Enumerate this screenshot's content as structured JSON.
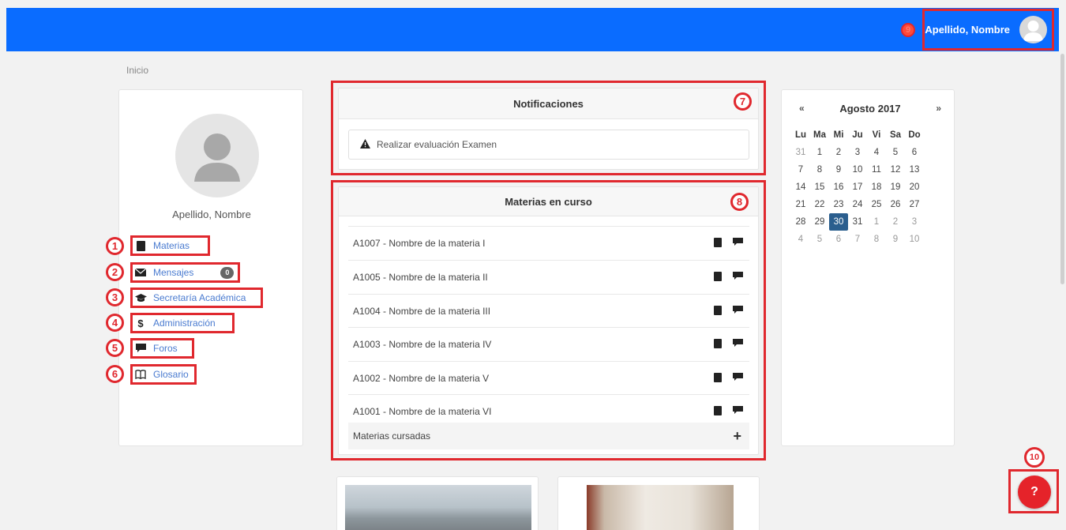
{
  "header": {
    "user_name": "Apellido, Nombre",
    "marker_user": "9",
    "accent_color": "#0a6cff"
  },
  "breadcrumb": "Inicio",
  "profile": {
    "name": "Apellido, Nombre",
    "menu": [
      {
        "marker": "1",
        "label": "Materias",
        "icon": "book-icon"
      },
      {
        "marker": "2",
        "label": "Mensajes",
        "icon": "envelope-icon",
        "count": "0"
      },
      {
        "marker": "3",
        "label": "Secretaría Académica",
        "icon": "graduation-cap-icon"
      },
      {
        "marker": "4",
        "label": "Administración",
        "icon": "dollar-icon"
      },
      {
        "marker": "5",
        "label": "Foros",
        "icon": "comment-icon"
      },
      {
        "marker": "6",
        "label": "Glosario",
        "icon": "open-book-icon"
      }
    ]
  },
  "notifications": {
    "title": "Notificaciones",
    "marker": "7",
    "items": [
      "Realizar evaluación Examen"
    ]
  },
  "courses": {
    "title": "Materias en curso",
    "marker": "8",
    "items": [
      "A1007 - Nombre de la materia I",
      "A1005 - Nombre de la materia II",
      "A1004 - Nombre de la materia III",
      "A1003 - Nombre de la materia IV",
      "A1002 - Nombre de la materia V",
      "A1001 - Nombre de la materia VI"
    ],
    "completed_label": "Materias cursadas",
    "completed_action": "+"
  },
  "calendar": {
    "prev": "«",
    "title": "Agosto 2017",
    "next": "»",
    "weekdays": [
      "Lu",
      "Ma",
      "Mi",
      "Ju",
      "Vi",
      "Sa",
      "Do"
    ],
    "days": [
      "31",
      "1",
      "2",
      "3",
      "4",
      "5",
      "6",
      "7",
      "8",
      "9",
      "10",
      "11",
      "12",
      "13",
      "14",
      "15",
      "16",
      "17",
      "18",
      "19",
      "20",
      "21",
      "22",
      "23",
      "24",
      "25",
      "26",
      "27",
      "28",
      "29",
      "30",
      "31",
      "1",
      "2",
      "3",
      "4",
      "5",
      "6",
      "7",
      "8",
      "9",
      "10"
    ],
    "selected": "30"
  },
  "help": {
    "marker": "10",
    "label": "?",
    "color": "#e5232a"
  },
  "annotation_color": "#e0282e"
}
